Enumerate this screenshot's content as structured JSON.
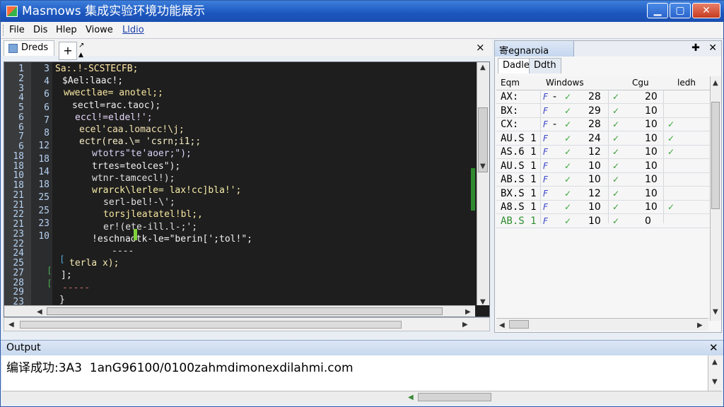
{
  "window": {
    "title": "Masmows 集成实验环境功能展示",
    "minimize": "▁",
    "maximize": "▢",
    "close": "✕"
  },
  "menu": [
    "File",
    "Dis",
    "Hlep",
    "Viowe",
    "Lldio"
  ],
  "editor": {
    "tab_label": "Dreds",
    "new_tab": "+",
    "close": "×",
    "line_numbers_a": [
      "1",
      "2",
      "3",
      "4",
      "5",
      "6",
      "6",
      "7",
      "6",
      "18",
      "18",
      "10",
      "18",
      "21",
      "21",
      "22",
      "21",
      "23",
      "22",
      "24",
      "25",
      "27",
      "28",
      "29",
      "23"
    ],
    "line_numbers_b": [
      "3",
      "4",
      "6",
      "6",
      "7",
      "8",
      "12",
      "18",
      "14",
      "18",
      "25",
      "25",
      "23",
      "10"
    ],
    "code_lines": [
      "Sa:.!-SCSTECFB;",
      "$Ael:laac!;",
      "wwectlae= anotel;;",
      "sectl=rac.taoc);",
      "eccl!=eldel!';",
      "ecel'caa.lomacc!\\j;",
      "ectr(rea.\\= 'csrn;i1;;",
      "wtotrs\"te'aoer;\");",
      "trtes=teolces\");",
      "wtnr-tamcecl!);",
      "wrarck\\lerle= lax!cc]bla!';",
      "serl-bel!-\\';",
      "torsjleatatel!bl;,",
      "er!(ete-ill.l-;';",
      "!eschnaotk-le=\"berin[';tol!\";",
      "----",
      "terla x);",
      "];",
      "-----",
      "}"
    ]
  },
  "registers": {
    "panel_title": "寄egnaroia",
    "pin": "✚",
    "close": "✕",
    "subtabs": [
      "Dadle",
      "Ddth"
    ],
    "columns": [
      "Eqm",
      "Windows",
      "Cgu",
      "ledh"
    ],
    "rows": [
      {
        "name": "AX:",
        "flag": "-",
        "v1": "28",
        "v2": "20"
      },
      {
        "name": "BX:",
        "flag": "",
        "v1": "29",
        "v2": "10"
      },
      {
        "name": "CX:",
        "flag": "-",
        "v1": "28",
        "v2": "10"
      },
      {
        "name": "AU.S 1",
        "flag": "",
        "v1": "24",
        "v2": "10"
      },
      {
        "name": "AS.6 1",
        "flag": "",
        "v1": "12",
        "v2": "10"
      },
      {
        "name": "AU.S 1",
        "flag": "",
        "v1": "10",
        "v2": "10"
      },
      {
        "name": "AB.S 1",
        "flag": "",
        "v1": "10",
        "v2": "10"
      },
      {
        "name": "BX.S 1",
        "flag": "",
        "v1": "12",
        "v2": "10"
      },
      {
        "name": "A8.S 1",
        "flag": "",
        "v1": "10",
        "v2": "10"
      },
      {
        "name": "AB.S 1",
        "flag": "",
        "v1": "10",
        "v2": "0"
      }
    ]
  },
  "output": {
    "title": "Output",
    "close": "✕",
    "text": "编译成功:3A3  1anG96100/0100zahmdimonexdilahmi.com"
  }
}
